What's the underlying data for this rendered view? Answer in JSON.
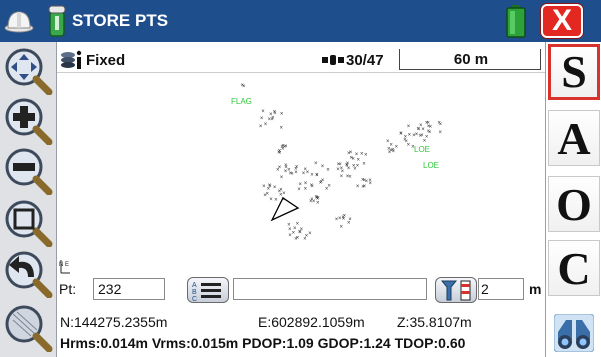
{
  "titlebar": {
    "title": "STORE PTS",
    "close_label": "X"
  },
  "status": {
    "fix": "Fixed",
    "satellites": "30/47",
    "scale": "60 m"
  },
  "left_toolbar": [
    "pan-zoom-tool",
    "zoom-in-tool",
    "zoom-out-tool",
    "zoom-extent-tool",
    "zoom-previous-tool",
    "zoom-window-tool"
  ],
  "right_toolbar": {
    "items": [
      {
        "label": "S"
      },
      {
        "label": "A"
      },
      {
        "label": "O"
      },
      {
        "label": "C"
      }
    ]
  },
  "map": {
    "north_arrow": "N E",
    "labels": [
      "FLAG",
      "LOE",
      "LOE"
    ]
  },
  "input_row": {
    "point_label": "Pt:",
    "point_value": "232",
    "code_value": "",
    "rod_height_value": "2",
    "unit": "m"
  },
  "coordinates": {
    "northing": "N:144275.2355m",
    "easting": "E:602892.1059m",
    "elevation": "Z:35.8107m"
  },
  "quality": "Hrms:0.014m Vrms:0.015m PDOP:1.09 GDOP:1.24 TDOP:0.60",
  "colors": {
    "titlebar": "#1f4e8c",
    "close": "#e32822",
    "label_green": "#2fc73a"
  }
}
